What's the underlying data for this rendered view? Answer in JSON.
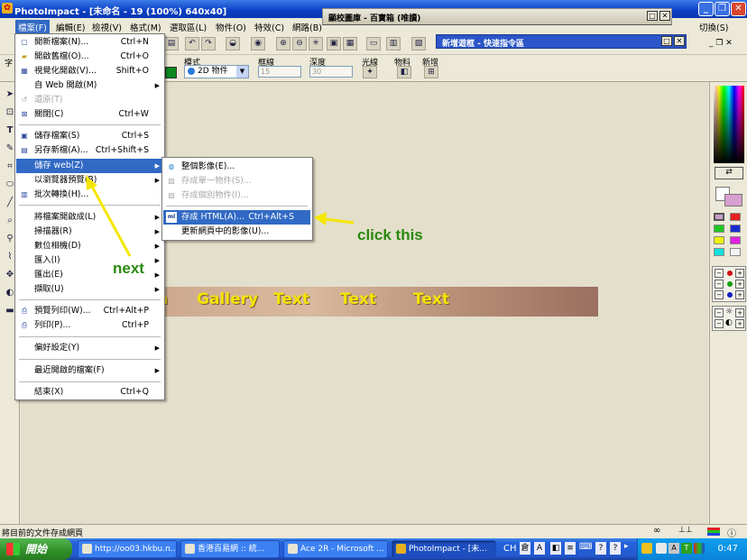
{
  "window": {
    "title": "PhotoImpact - [未命名 - 19 (100%) 640x40]"
  },
  "menubar": {
    "items": [
      "檔案(F)",
      "編輯(E)",
      "檢視(V)",
      "格式(M)",
      "選取區(L)",
      "物件(O)",
      "特效(C)",
      "網路(B)"
    ],
    "right_item": "切換(S)"
  },
  "panels": {
    "easy_palette": "顯校圖庫 - 百寶箱 (唯讀)",
    "quick_command": "新增遊框 - 快速指令區"
  },
  "toolbar2": {
    "mode_label": "模式",
    "mode_value": "2D 物件",
    "border_label": "框線",
    "border_value": "15",
    "depth_label": "深度",
    "depth_value": "30",
    "light_label": "光線",
    "material_label": "物料",
    "add_label": "新增"
  },
  "file_menu": {
    "items": [
      {
        "label": "開新檔案(N)...",
        "shortcut": "Ctrl+N",
        "icon": "new-file-icon"
      },
      {
        "label": "開啟舊檔(O)...",
        "shortcut": "Ctrl+O",
        "icon": "open-folder-icon"
      },
      {
        "label": "視覺化開啟(V)...",
        "shortcut": "Shift+O",
        "icon": "visual-open-icon"
      },
      {
        "label": "自 Web 開啟(M)",
        "shortcut": "",
        "icon": "",
        "submenu": true
      },
      {
        "label": "還原(T)",
        "shortcut": "",
        "icon": "revert-icon",
        "disabled": true
      },
      {
        "label": "關閉(C)",
        "shortcut": "Ctrl+W",
        "icon": "close-file-icon"
      },
      {
        "label": "儲存檔案(S)",
        "shortcut": "Ctrl+S",
        "icon": "save-icon"
      },
      {
        "label": "另存新檔(A)...",
        "shortcut": "Ctrl+Shift+S",
        "icon": "save-as-icon"
      },
      {
        "label": "儲存 web(Z)",
        "shortcut": "",
        "icon": "",
        "submenu": true,
        "highlighted": true
      },
      {
        "label": "以瀏覽器預覽(B)",
        "shortcut": "",
        "icon": "",
        "submenu": true
      },
      {
        "label": "批次轉換(H)...",
        "shortcut": "",
        "icon": "batch-convert-icon"
      },
      {
        "label": "將檔案開啟成(L)",
        "shortcut": "",
        "icon": "",
        "submenu": true
      },
      {
        "label": "掃描器(R)",
        "shortcut": "",
        "icon": "",
        "submenu": true
      },
      {
        "label": "數位相機(D)",
        "shortcut": "",
        "icon": "",
        "submenu": true
      },
      {
        "label": "匯入(I)",
        "shortcut": "",
        "icon": "",
        "submenu": true
      },
      {
        "label": "匯出(E)",
        "shortcut": "",
        "icon": "",
        "submenu": true
      },
      {
        "label": "擷取(U)",
        "shortcut": "",
        "icon": "",
        "submenu": true
      },
      {
        "label": "預覽列印(W)...",
        "shortcut": "Ctrl+Alt+P",
        "icon": "print-preview-icon"
      },
      {
        "label": "列印(P)...",
        "shortcut": "Ctrl+P",
        "icon": "print-icon"
      },
      {
        "label": "偏好設定(Y)",
        "shortcut": "",
        "icon": "",
        "submenu": true
      },
      {
        "label": "最近開啟的檔案(F)",
        "shortcut": "",
        "icon": "",
        "submenu": true
      },
      {
        "label": "結束(X)",
        "shortcut": "Ctrl+Q",
        "icon": ""
      }
    ]
  },
  "save_web_submenu": {
    "items": [
      {
        "label": "整個影像(E)...",
        "shortcut": "",
        "icon": "globe-icon",
        "disabled": false
      },
      {
        "label": "存成單一物件(S)...",
        "shortcut": "",
        "icon": "single-object-icon",
        "disabled": true
      },
      {
        "label": "存成個別物件(I)...",
        "shortcut": "",
        "icon": "multi-object-icon",
        "disabled": true
      },
      {
        "label": "存成 HTML(A)...",
        "shortcut": "Ctrl+Alt+S",
        "icon": "html-icon",
        "disabled": false,
        "highlighted": true
      },
      {
        "label": "更新網頁中的影像(U)...",
        "shortcut": "",
        "icon": "",
        "disabled": false
      }
    ]
  },
  "banner": {
    "texts": [
      "n",
      "Gallery",
      "Text",
      "Text",
      "Text"
    ]
  },
  "annotations": {
    "next": "next",
    "click_this": "click this",
    "color": "#2a8a10"
  },
  "statusbar": {
    "text": "將目前的文件存成網頁"
  },
  "taskbar": {
    "start_label": "開始",
    "tasks": [
      "http://oo03.hkbu.n...",
      "香港百易網 :: 統...",
      "Ace 2R - Microsoft ...",
      "PhotoImpact - [未..."
    ],
    "input_method": "CH",
    "clock": "0:47"
  }
}
